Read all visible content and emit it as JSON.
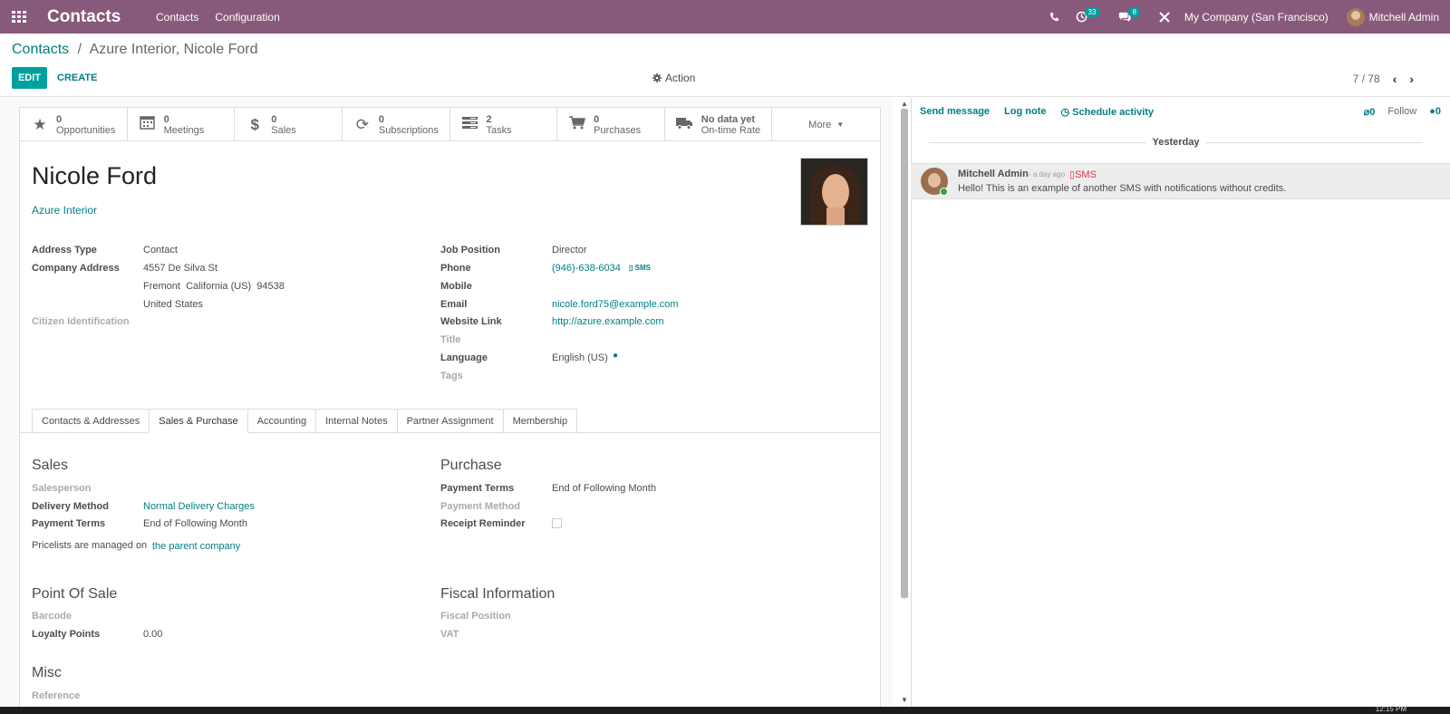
{
  "navbar": {
    "brand": "Contacts",
    "menus": [
      "Contacts",
      "Configuration"
    ],
    "activity_badge": "33",
    "message_badge": "8",
    "company": "My Company (San Francisco)",
    "user": "Mitchell Admin",
    "color": "#875a7b"
  },
  "control": {
    "breadcrumb_root": "Contacts",
    "breadcrumb_sep": "/",
    "breadcrumb_current": "Azure Interior, Nicole Ford",
    "edit_label": "EDIT",
    "create_label": "CREATE",
    "action_label": "Action",
    "pager": "7 / 78"
  },
  "smart_buttons": [
    {
      "icon": "star-icon",
      "value": "0",
      "label": "Opportunities"
    },
    {
      "icon": "calendar-icon",
      "value": "0",
      "label": "Meetings"
    },
    {
      "icon": "dollar-icon",
      "value": "0",
      "label": "Sales"
    },
    {
      "icon": "refresh-icon",
      "value": "0",
      "label": "Subscriptions"
    },
    {
      "icon": "tasks-icon",
      "value": "2",
      "label": "Tasks"
    },
    {
      "icon": "cart-icon",
      "value": "0",
      "label": "Purchases"
    },
    {
      "icon": "truck-icon",
      "value": "No data yet",
      "label": "On-time Rate"
    }
  ],
  "more_label": "More",
  "partner": {
    "name": "Nicole Ford",
    "company": "Azure Interior"
  },
  "left_fields": {
    "address_type_label": "Address Type",
    "address_type_value": "Contact",
    "company_address_label": "Company Address",
    "street": "4557 De Silva St",
    "city_line": "Fremont  California (US)  94538",
    "country": "United States",
    "citizen_label": "Citizen Identification"
  },
  "right_fields": {
    "job_label": "Job Position",
    "job_value": "Director",
    "phone_label": "Phone",
    "phone_value": "(946)-638-6034",
    "sms_label": "SMS",
    "mobile_label": "Mobile",
    "email_label": "Email",
    "email_value": "nicole.ford75@example.com",
    "website_label": "Website Link",
    "website_value": "http://azure.example.com",
    "title_label": "Title",
    "language_label": "Language",
    "language_value": "English (US)",
    "tags_label": "Tags"
  },
  "tabs": [
    "Contacts & Addresses",
    "Sales & Purchase",
    "Accounting",
    "Internal Notes",
    "Partner Assignment",
    "Membership"
  ],
  "sales": {
    "title": "Sales",
    "salesperson_label": "Salesperson",
    "delivery_label": "Delivery Method",
    "delivery_value": "Normal Delivery Charges",
    "payment_terms_label": "Payment Terms",
    "payment_terms_value": "End of Following Month",
    "pricelist_text": "Pricelists are managed on",
    "pricelist_link": "the parent company"
  },
  "purchase": {
    "title": "Purchase",
    "payment_terms_label": "Payment Terms",
    "payment_terms_value": "End of Following Month",
    "payment_method_label": "Payment Method",
    "receipt_label": "Receipt Reminder"
  },
  "pos": {
    "title": "Point Of Sale",
    "barcode_label": "Barcode",
    "loyalty_label": "Loyalty Points",
    "loyalty_value": "0.00"
  },
  "fiscal": {
    "title": "Fiscal Information",
    "position_label": "Fiscal Position",
    "vat_label": "VAT"
  },
  "misc": {
    "title": "Misc",
    "reference_label": "Reference"
  },
  "chatter": {
    "send_message": "Send message",
    "log_note": "Log note",
    "schedule_activity": "Schedule activity",
    "attachments": "0",
    "follow": "Follow",
    "followers": "0",
    "day_separator": "Yesterday",
    "message": {
      "author": "Mitchell Admin",
      "time": "- a day ago",
      "type": "SMS",
      "body": "Hello! This is an example of another SMS with notifications without credits."
    }
  },
  "taskbar": {
    "clock": "12:15 PM"
  }
}
